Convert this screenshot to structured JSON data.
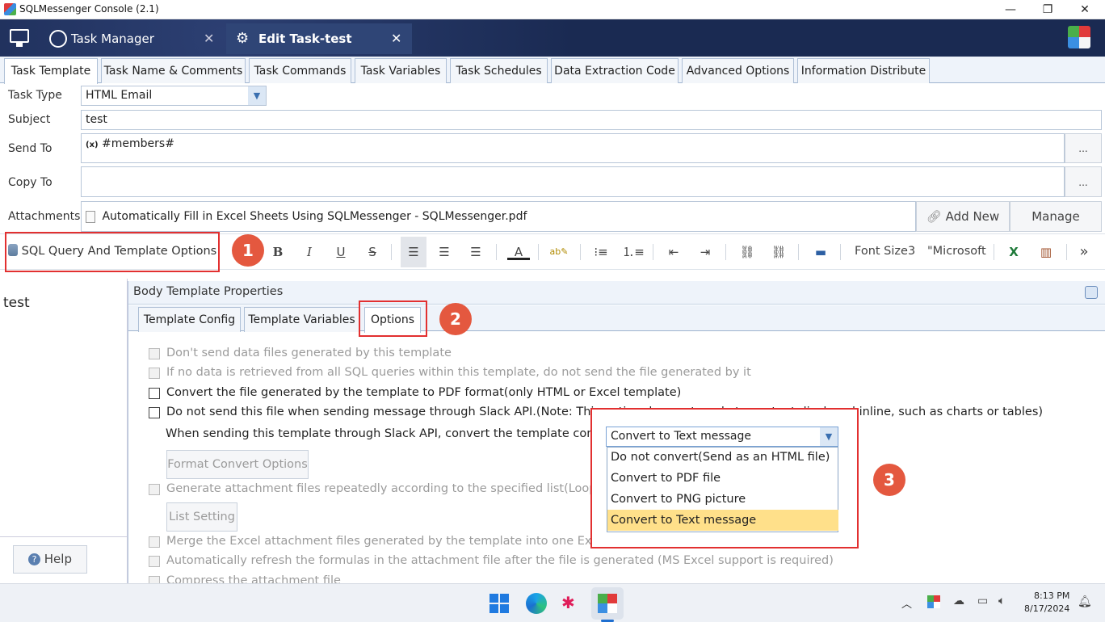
{
  "window": {
    "title": "SQLMessenger Console (2.1)",
    "minimize": "—",
    "maximize": "❐",
    "close": "✕"
  },
  "header": {
    "tabs": [
      {
        "label": "Task Manager",
        "icon": "cloud-icon"
      },
      {
        "label": "Edit Task-test",
        "icon": "gear-icon"
      }
    ],
    "close": "✕"
  },
  "tabs": [
    "Task Template",
    "Task Name & Comments",
    "Task Commands",
    "Task Variables",
    "Task Schedules",
    "Data Extraction Code",
    "Advanced Options",
    "Information Distribute"
  ],
  "form": {
    "task_type_label": "Task Type",
    "task_type_value": "HTML Email",
    "subject_label": "Subject",
    "subject_value": "test",
    "send_to_label": "Send To",
    "send_to_prefix": "(x)",
    "send_to_value": "#members#",
    "copy_to_label": "Copy To",
    "copy_to_value": "",
    "browse": "...",
    "attachments_label": "Attachments",
    "attachment_file": "Automatically Fill in Excel Sheets Using SQLMessenger - SQLMessenger.pdf",
    "add_new": "Add New",
    "manage": "Manage"
  },
  "toolbar": {
    "sql_options": "SQL Query And Template Options",
    "bold": "B",
    "italic": "I",
    "underline": "U",
    "strike": "S",
    "font_size": "Font Size3",
    "font_name": "\"Microsoft",
    "more": "»"
  },
  "badges": [
    "1",
    "2",
    "3"
  ],
  "editor": {
    "body_text": "test",
    "help": "Help"
  },
  "panel": {
    "title": "Body Template Properties",
    "tabs": [
      "Template Config",
      "Template Variables",
      "Options"
    ],
    "options": [
      {
        "text": "Don't send data files generated by this template",
        "enabled": false
      },
      {
        "text": "If no data is retrieved from all SQL queries within this template, do not send the file generated by it",
        "enabled": false
      },
      {
        "text": "Convert the file generated by the template to PDF format(only HTML or Excel template)",
        "enabled": true
      },
      {
        "text": "Do not send this file when sending message through Slack API.(Note: This option does not apply to content displayed inline, such as charts or tables)",
        "enabled": true
      }
    ],
    "slack_label": "When sending this template through Slack API, convert the template content to",
    "format_convert": "Format Convert Options",
    "loop_option": "Generate attachment files repeatedly according to the specified list(Loop Template)",
    "list_setting": "List Setting",
    "merge_option": "Merge the Excel attachment files generated by the template into one Excel file",
    "refresh_option": "Automatically refresh the formulas in the attachment file after the file is generated (MS Excel support is required)",
    "compress_option": "Compress the attachment file"
  },
  "dropdown": {
    "selected": "Convert to Text message",
    "options": [
      "Do not convert(Send as an HTML file)",
      "Convert to PDF file",
      "Convert to PNG picture",
      "Convert to Text message"
    ],
    "highlight_index": 3,
    "highlight_color": "#ffe08a"
  },
  "taskbar": {
    "time": "8:13 PM",
    "date": "8/17/2024"
  }
}
